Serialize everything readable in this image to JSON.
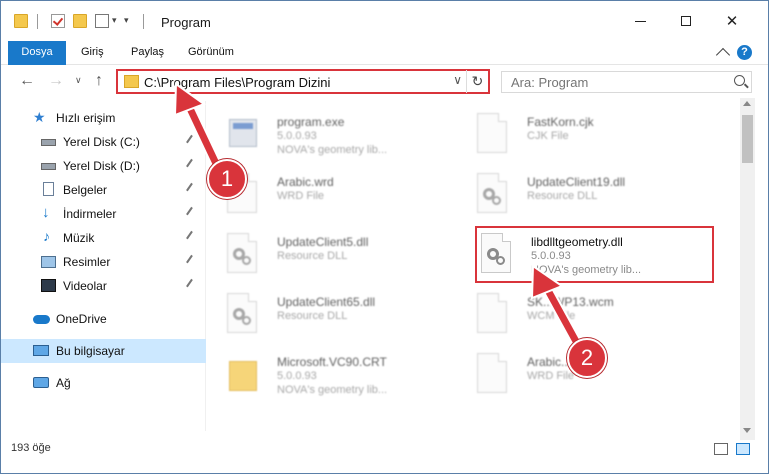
{
  "window": {
    "title": "Program",
    "controls": {
      "minimize": "minimize",
      "maximize": "maximize",
      "close": "✕"
    }
  },
  "ribbon": {
    "tabs": [
      "Dosya",
      "Giriş",
      "Paylaş",
      "Görünüm"
    ],
    "help": "?"
  },
  "address": {
    "path": "C:\\Program Files\\Program Dizini",
    "search_placeholder": "Ara: Program"
  },
  "sidebar": {
    "items": [
      {
        "label": "Hızlı erişim",
        "icon": "star-icon"
      },
      {
        "label": "Yerel Disk (C:)",
        "icon": "drive-icon",
        "pinned": true
      },
      {
        "label": "Yerel Disk (D:)",
        "icon": "drive-icon",
        "pinned": true
      },
      {
        "label": "Belgeler",
        "icon": "documents-icon",
        "pinned": true
      },
      {
        "label": "İndirmeler",
        "icon": "download-icon",
        "pinned": true
      },
      {
        "label": "Müzik",
        "icon": "music-icon",
        "pinned": true
      },
      {
        "label": "Resimler",
        "icon": "pictures-icon",
        "pinned": true
      },
      {
        "label": "Videolar",
        "icon": "videos-icon",
        "pinned": true
      },
      {
        "label": "OneDrive",
        "icon": "cloud-icon"
      },
      {
        "label": "Bu bilgisayar",
        "icon": "computer-icon",
        "selected": true
      },
      {
        "label": "Ağ",
        "icon": "network-icon"
      }
    ]
  },
  "files": [
    {
      "name": "program.exe",
      "line2": "5.0.0.93",
      "line3": "NOVA's geometry lib...",
      "icon": "exe-icon"
    },
    {
      "name": "FastKorn.cjk",
      "line2": "CJK File",
      "line3": "",
      "icon": "file-icon"
    },
    {
      "name": "Arabic.wrd",
      "line2": "WRD File",
      "line3": "",
      "icon": "file-icon"
    },
    {
      "name": "UpdateClient19.dll",
      "line2": "Resource DLL",
      "line3": "",
      "icon": "dll-icon"
    },
    {
      "name": "UpdateClient5.dll",
      "line2": "Resource DLL",
      "line3": "",
      "icon": "dll-icon"
    },
    {
      "name": "libdlltgeometry.dll",
      "line2": "5.0.0.93",
      "line3": "NOVA's geometry lib...",
      "icon": "dll-icon"
    },
    {
      "name": "UpdateClient65.dll",
      "line2": "Resource DLL",
      "line3": "",
      "icon": "dll-icon"
    },
    {
      "name": "SK...WP13.wcm",
      "line2": "WCM File",
      "line3": "",
      "icon": "file-icon"
    },
    {
      "name": "Microsoft.VC90.CRT",
      "line2": "5.0.0.93",
      "line3": "NOVA's geometry lib...",
      "icon": "folder-icon"
    },
    {
      "name": "Arabic...",
      "line2": "WRD File",
      "line3": "",
      "icon": "file-icon"
    }
  ],
  "status": {
    "count": "193 öğe"
  },
  "annotations": {
    "badge1": "1",
    "badge2": "2",
    "color": "#d9343b"
  }
}
